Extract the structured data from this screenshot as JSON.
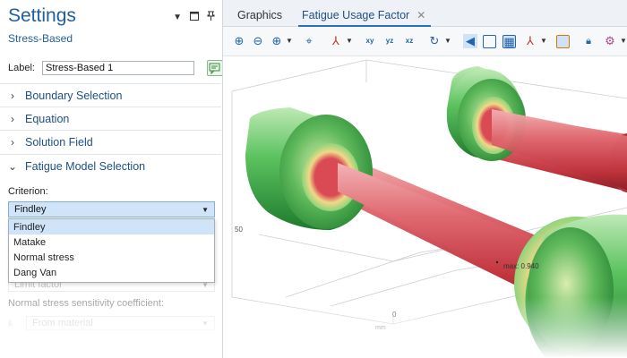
{
  "settings": {
    "title": "Settings",
    "subtitle": "Stress-Based",
    "label_caption": "Label:",
    "label_value": "Stress-Based 1",
    "sections": [
      "Boundary Selection",
      "Equation",
      "Solution Field",
      "Fatigue Model Selection"
    ],
    "criterion_label": "Criterion:",
    "criterion_value": "Findley",
    "criterion_options": [
      "Findley",
      "Matake",
      "Normal stress",
      "Dang Van"
    ],
    "limit_value": "Limit factor",
    "normal_stress_label": "Normal stress sensitivity coefficient:",
    "k_symbol": "k",
    "k_value": "From material"
  },
  "graphics": {
    "tabs": [
      "Graphics",
      "Fatigue Usage Factor"
    ],
    "axis_tick_50": "50",
    "axis_tick_0": "0",
    "axis_unit": "mm",
    "max_label": "max: 0.940",
    "colors": {
      "low": "#3cb34a",
      "high": "#d8454f",
      "mid": "#e9e3a0"
    }
  }
}
